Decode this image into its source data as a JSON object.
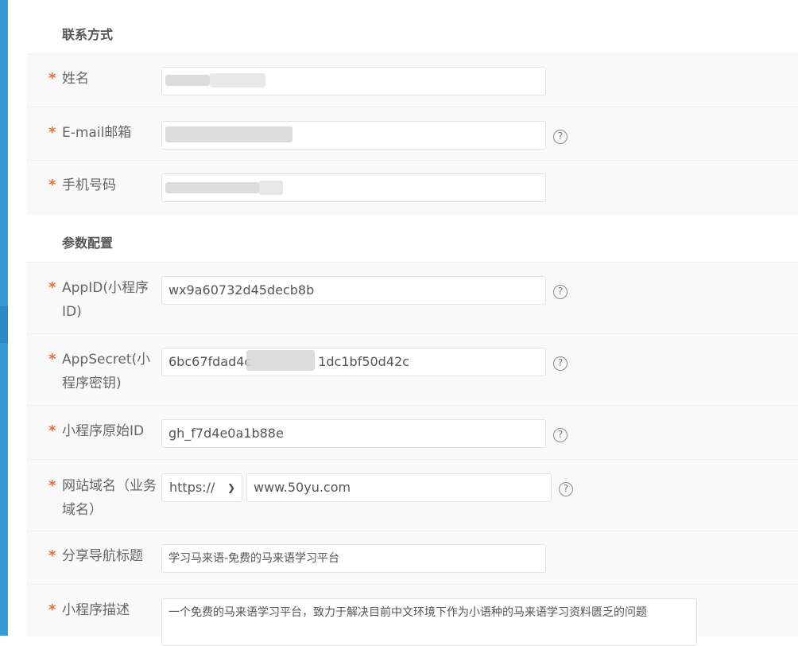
{
  "sections": {
    "contact_title": "联系方式",
    "params_title": "参数配置"
  },
  "required_mark": "*",
  "help_glyph": "?",
  "fields": {
    "name": {
      "label": "姓名",
      "value": ""
    },
    "email": {
      "label": "E-mail邮箱",
      "value": ""
    },
    "phone": {
      "label": "手机号码",
      "value": ""
    },
    "appid": {
      "label": "AppID(小程序ID)",
      "value": "wx9a60732d45decb8b"
    },
    "appsecret": {
      "label": "AppSecret(小程序密钥)",
      "value_start": "6bc67fdad4c",
      "value_end": "1dc1bf50d42c"
    },
    "original_id": {
      "label": "小程序原始ID",
      "value": "gh_f7d4e0a1b88e"
    },
    "domain": {
      "label": "网站域名（业务域名）",
      "protocol": "https://",
      "value": "www.50yu.com"
    },
    "share_title": {
      "label": "分享导航标题",
      "value": "学习马来语-免费的马来语学习平台"
    },
    "description": {
      "label": "小程序描述",
      "value": "一个免费的马来语学习平台，致力于解决目前中文环境下作为小语种的马来语学习资料匮乏的问题"
    }
  },
  "colors": {
    "required": "#f26b2c",
    "sidebar": "#3a9ad6",
    "row_bg": "#f9f9f9"
  },
  "icons": {
    "help": "question-circle-icon",
    "dropdown": "chevron-down-icon"
  }
}
